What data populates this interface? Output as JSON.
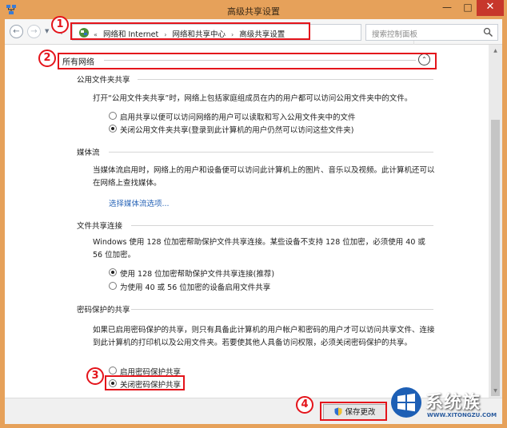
{
  "window": {
    "title": "高级共享设置",
    "minimize": "—",
    "maximize": "□",
    "close": "✕"
  },
  "nav": {
    "back": "←",
    "forward": "→",
    "up": "↑",
    "breadcrumbs": [
      "网络和 Internet",
      "网络和共享中心",
      "高级共享设置"
    ],
    "breadcrumb_prefix": "«",
    "breadcrumb_sep": "›",
    "refresh": "↻",
    "search_placeholder": "搜索控制面板"
  },
  "profile": {
    "title": "所有网络",
    "collapse": "⌃"
  },
  "public_folder": {
    "heading": "公用文件夹共享",
    "desc": "打开“公用文件夹共享”时，网络上包括家庭组成员在内的用户都可以访问公用文件夹中的文件。",
    "options": [
      {
        "label": "启用共享以便可以访问网络的用户可以读取和写入公用文件夹中的文件",
        "checked": false
      },
      {
        "label": "关闭公用文件夹共享(登录到此计算机的用户仍然可以访问这些文件夹)",
        "checked": true
      }
    ]
  },
  "media": {
    "heading": "媒体流",
    "desc": "当媒体流启用时，网络上的用户和设备便可以访问此计算机上的图片、音乐以及视频。此计算机还可以在网络上查找媒体。",
    "link": "选择媒体流选项..."
  },
  "file_sharing": {
    "heading": "文件共享连接",
    "desc": "Windows 使用 128 位加密帮助保护文件共享连接。某些设备不支持 128 位加密，必须使用 40 或 56 位加密。",
    "options": [
      {
        "label": "使用 128 位加密帮助保护文件共享连接(推荐)",
        "checked": true
      },
      {
        "label": "为使用 40 或 56 位加密的设备启用文件共享",
        "checked": false
      }
    ]
  },
  "password": {
    "heading": "密码保护的共享",
    "desc": "如果已启用密码保护的共享，则只有具备此计算机的用户帐户和密码的用户才可以访问共享文件、连接到此计算机的打印机以及公用文件夹。若要使其他人具备访问权限，必须关闭密码保护的共享。",
    "options": [
      {
        "label": "启用密码保护共享",
        "checked": false
      },
      {
        "label": "关闭密码保护共享",
        "checked": true
      }
    ]
  },
  "footer": {
    "save": "保存更改"
  },
  "annotations": [
    "1",
    "2",
    "3",
    "4"
  ],
  "watermark": {
    "text": "系统族",
    "url": "WWW.XITONGZU.COM"
  },
  "colors": {
    "frame": "#e6a15a",
    "annotation": "#e4141b",
    "link": "#2a66b8",
    "close": "#c7372b"
  }
}
